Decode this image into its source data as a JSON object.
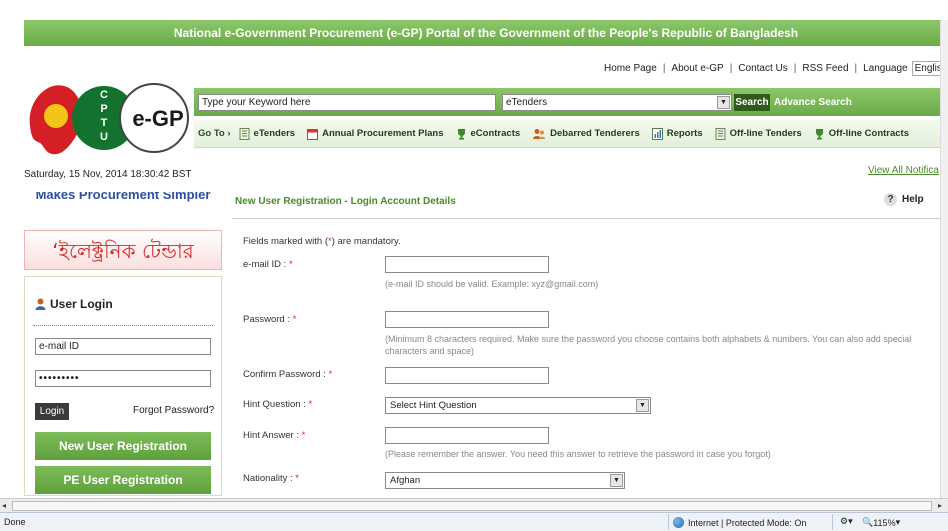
{
  "banner": {
    "title": "National e-Government Procurement (e-GP) Portal of the Government of the People's Republic of Bangladesh"
  },
  "toplinks": {
    "home": "Home Page",
    "about": "About e-GP",
    "contact": "Contact Us",
    "rss": "RSS Feed",
    "language_label": "Language",
    "language_value": "English"
  },
  "logo": {
    "cptu": "CPTU",
    "egp": "e-GP"
  },
  "search": {
    "keyword_placeholder": "Type your Keyword here",
    "category_value": "eTenders",
    "search_label": "Search",
    "advance_label": "Advance Search"
  },
  "nav": {
    "goto": "Go To",
    "items": [
      {
        "label": "eTenders",
        "icon": "document-icon"
      },
      {
        "label": "Annual Procurement Plans",
        "icon": "calendar-icon"
      },
      {
        "label": "eContracts",
        "icon": "trophy-icon"
      },
      {
        "label": "Debarred Tenderers",
        "icon": "people-icon"
      },
      {
        "label": "Reports",
        "icon": "report-icon"
      },
      {
        "label": "Off-line Tenders",
        "icon": "document-icon"
      },
      {
        "label": "Off-line Contracts",
        "icon": "trophy-icon"
      }
    ]
  },
  "datetime": "Saturday, 15 Nov, 2014 18:30:42 BST",
  "view_all": "View All Notifica",
  "left": {
    "strip_text": "Makes Procurement Simpler",
    "bengali_banner": "‘ইলেক্ট্রনিক টেন্ডার",
    "login": {
      "title": "User Login",
      "email_value": "e-mail ID",
      "password_value": "•••••••••",
      "login_button": "Login",
      "forgot": "Forgot Password?",
      "new_user": "New User Registration",
      "pe_user": "PE User Registration"
    }
  },
  "form": {
    "title": "New User Registration - Login Account Details",
    "help": "Help",
    "mandatory_prefix": "Fields marked with (",
    "mandatory_star": "*",
    "mandatory_suffix": ") are mandatory.",
    "email_label": "e-mail ID :",
    "email_hint": "(e-mail ID should be valid. Example: xyz@gmail.com)",
    "password_label": "Password :",
    "password_hint": "(Minimum 8 characters required. Make sure the password you choose contains both alphabets & numbers. You can also add special characters and space)",
    "confirm_label": "Confirm Password :",
    "hint_q_label": "Hint Question :",
    "hint_q_value": "Select Hint Question",
    "hint_a_label": "Hint Answer :",
    "hint_a_hint": "(Please remember the answer. You need this answer to retrieve the password in case you forgot)",
    "nationality_label": "Nationality :",
    "nationality_value": "Afghan",
    "req": "*"
  },
  "status": {
    "done": "Done",
    "zone": "Internet | Protected Mode: On",
    "zoom": "115%"
  },
  "colors": {
    "green": "#6aaa48",
    "dark_green": "#2e5a1c",
    "red": "#d32828",
    "link_green": "#4a8a2a"
  }
}
